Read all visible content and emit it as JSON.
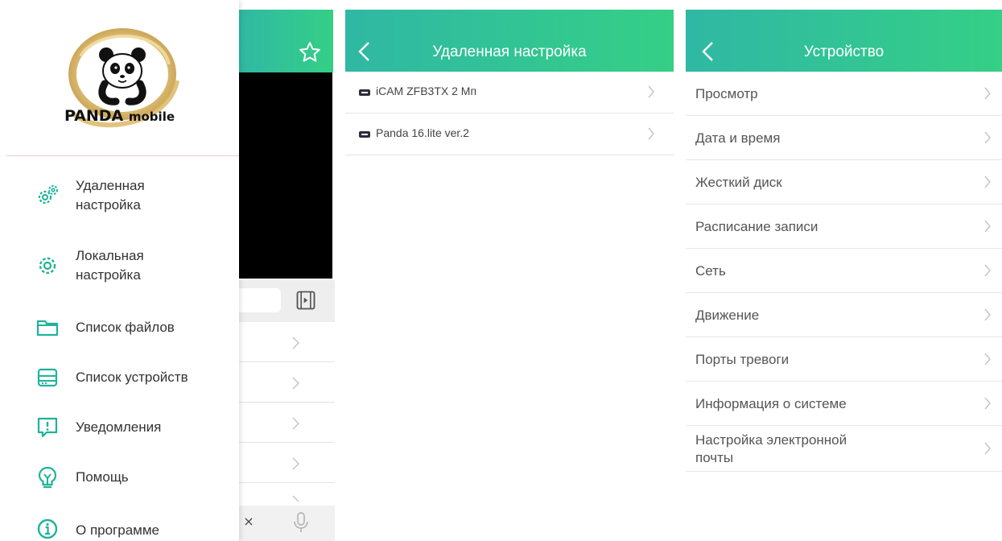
{
  "drawer": {
    "brand": "PANDA",
    "brand_small": "mobile",
    "items": [
      {
        "label_line1": "Удаленная",
        "label_line2": "настройка",
        "icon": "gears-icon"
      },
      {
        "label_line1": "Локальная",
        "label_line2": "настройка",
        "icon": "gear-icon"
      },
      {
        "label_line1": "Список файлов",
        "label_line2": "",
        "icon": "folder-icon"
      },
      {
        "label_line1": "Список устройств",
        "label_line2": "",
        "icon": "device-list-icon"
      },
      {
        "label_line1": "Уведомления",
        "label_line2": "",
        "icon": "alert-icon"
      },
      {
        "label_line1": "Помощь",
        "label_line2": "",
        "icon": "lightbulb-icon"
      },
      {
        "label_line1": "О программе",
        "label_line2": "",
        "icon": "info-icon"
      }
    ]
  },
  "background_app": {
    "keyboard_close": "×"
  },
  "remote_settings": {
    "title": "Удаленная настройка",
    "devices": [
      "iCAM ZFB3TX 2 Мп",
      "Panda 16.lite ver.2"
    ]
  },
  "device_settings": {
    "title": "Устройство",
    "items": [
      {
        "line1": "Просмотр",
        "line2": ""
      },
      {
        "line1": "Дата и время",
        "line2": ""
      },
      {
        "line1": "Жесткий диск",
        "line2": ""
      },
      {
        "line1": "Расписание записи",
        "line2": ""
      },
      {
        "line1": "Сеть",
        "line2": ""
      },
      {
        "line1": "Движение",
        "line2": ""
      },
      {
        "line1": "Порты тревоги",
        "line2": ""
      },
      {
        "line1": "Информация о системе",
        "line2": ""
      },
      {
        "line1": "Настройка электронной",
        "line2": "почты"
      }
    ]
  },
  "colors": {
    "header_start": "#2fb8a4",
    "header_end": "#35cf86",
    "accent": "#1fb39a"
  }
}
